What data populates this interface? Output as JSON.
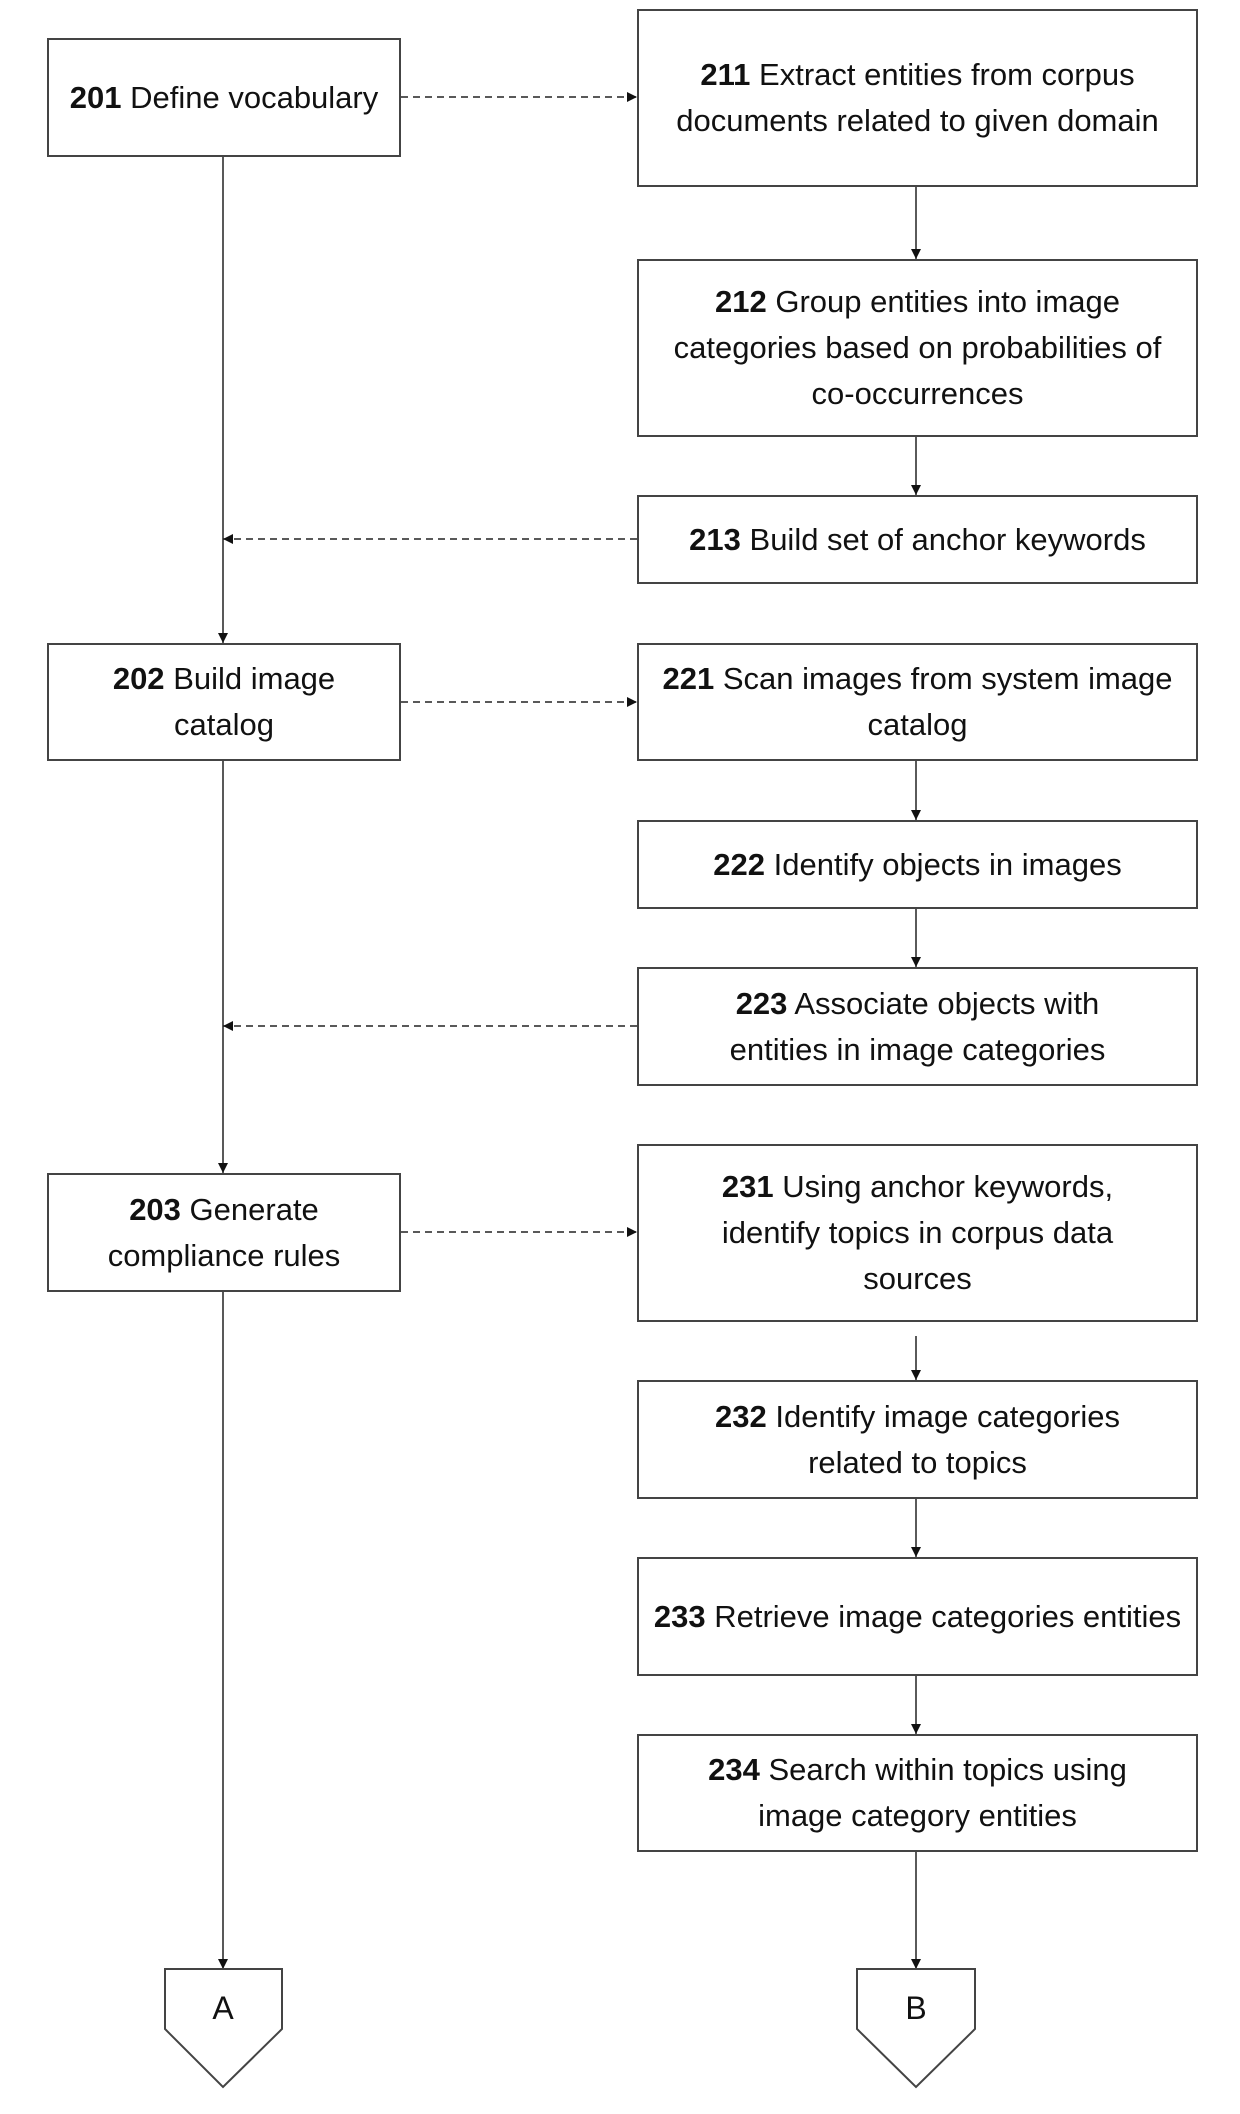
{
  "chart_data": {
    "type": "flowchart",
    "nodes": [
      {
        "id": "201",
        "text": "Define vocabulary",
        "column": "left"
      },
      {
        "id": "202",
        "text": "Build image catalog",
        "column": "left"
      },
      {
        "id": "203",
        "text": "Generate compliance rules",
        "column": "left"
      },
      {
        "id": "211",
        "text": "Extract entities from corpus documents related to given domain",
        "column": "right"
      },
      {
        "id": "212",
        "text": "Group entities into image categories based on probabilities of co-occurrences",
        "column": "right"
      },
      {
        "id": "213",
        "text": "Build set of anchor keywords",
        "column": "right"
      },
      {
        "id": "221",
        "text": "Scan images from system image catalog",
        "column": "right"
      },
      {
        "id": "222",
        "text": "Identify objects in images",
        "column": "right"
      },
      {
        "id": "223",
        "text": "Associate objects with entities in image categories",
        "column": "right"
      },
      {
        "id": "231",
        "text": "Using anchor keywords, identify topics in corpus data sources",
        "column": "right"
      },
      {
        "id": "232",
        "text": "Identify image categories related to topics",
        "column": "right"
      },
      {
        "id": "233",
        "text": "Retrieve image categories entities",
        "column": "right"
      },
      {
        "id": "234",
        "text": "Search within topics using image category entities",
        "column": "right"
      }
    ],
    "connectors": [
      {
        "id": "A",
        "label": "A"
      },
      {
        "id": "B",
        "label": "B"
      }
    ],
    "edges": [
      {
        "from": "201",
        "to": "202",
        "style": "solid"
      },
      {
        "from": "202",
        "to": "203",
        "style": "solid"
      },
      {
        "from": "203",
        "to": "A",
        "style": "solid"
      },
      {
        "from": "201",
        "to": "211",
        "style": "dashed"
      },
      {
        "from": "211",
        "to": "212",
        "style": "solid"
      },
      {
        "from": "212",
        "to": "213",
        "style": "solid"
      },
      {
        "from": "213",
        "to": "201-202-line",
        "style": "dashed"
      },
      {
        "from": "202",
        "to": "221",
        "style": "dashed"
      },
      {
        "from": "221",
        "to": "222",
        "style": "solid"
      },
      {
        "from": "222",
        "to": "223",
        "style": "solid"
      },
      {
        "from": "223",
        "to": "202-203-line",
        "style": "dashed"
      },
      {
        "from": "203",
        "to": "231",
        "style": "dashed"
      },
      {
        "from": "231",
        "to": "232",
        "style": "solid"
      },
      {
        "from": "232",
        "to": "233",
        "style": "solid"
      },
      {
        "from": "233",
        "to": "234",
        "style": "solid"
      },
      {
        "from": "234",
        "to": "B",
        "style": "solid"
      }
    ]
  }
}
